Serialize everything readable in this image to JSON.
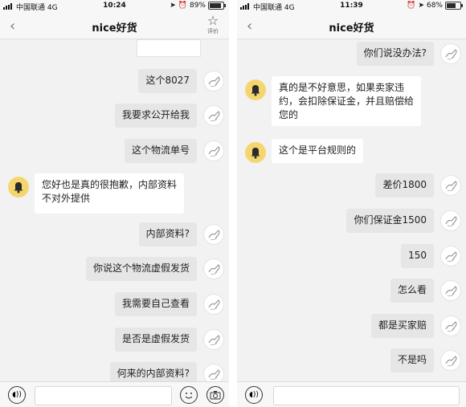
{
  "left": {
    "status": {
      "carrier": "中国联通",
      "network": "4G",
      "time": "10:24",
      "battery": "89%",
      "battery_level": 0.89
    },
    "nav": {
      "back_icon": "chevron-left-icon",
      "title": "nice好货",
      "rate_label": "评价"
    },
    "messages": [
      {
        "from": "user",
        "text": "这个8027"
      },
      {
        "from": "user",
        "text": "我要求公开给我"
      },
      {
        "from": "user",
        "text": "这个物流单号"
      },
      {
        "from": "service",
        "text": "您好也是真的很抱歉，内部资料\n不对外提供"
      },
      {
        "from": "user",
        "text": "内部资料?"
      },
      {
        "from": "user",
        "text": "你说这个物流虚假发货"
      },
      {
        "from": "user",
        "text": "我需要自己查看"
      },
      {
        "from": "user",
        "text": "是否是虚假发货"
      },
      {
        "from": "user",
        "text": "何来的内部资料?"
      }
    ],
    "input": {
      "placeholder": ""
    }
  },
  "right": {
    "status": {
      "carrier": "中国联通",
      "network": "4G",
      "time": "11:39",
      "battery": "68%",
      "battery_level": 0.68
    },
    "nav": {
      "back_icon": "chevron-left-icon",
      "title": "nice好货"
    },
    "messages": [
      {
        "from": "user",
        "text": "你们说没办法?"
      },
      {
        "from": "service",
        "text": "真的是不好意思，如果卖家违\n约，会扣除保证金，并且赔偿给\n您的"
      },
      {
        "from": "service",
        "text": "这个是平台规则的"
      },
      {
        "from": "user",
        "text": "差价1800"
      },
      {
        "from": "user",
        "text": "你们保证金1500"
      },
      {
        "from": "user",
        "text": "150"
      },
      {
        "from": "user",
        "text": "怎么看"
      },
      {
        "from": "user",
        "text": "都是买家赔"
      },
      {
        "from": "user",
        "text": "不是吗"
      }
    ],
    "input": {
      "placeholder": ""
    }
  },
  "colors": {
    "service_avatar": "#f5d66e",
    "user_bubble": "#e6e6e6",
    "chat_bg": "#f2f2f2"
  }
}
